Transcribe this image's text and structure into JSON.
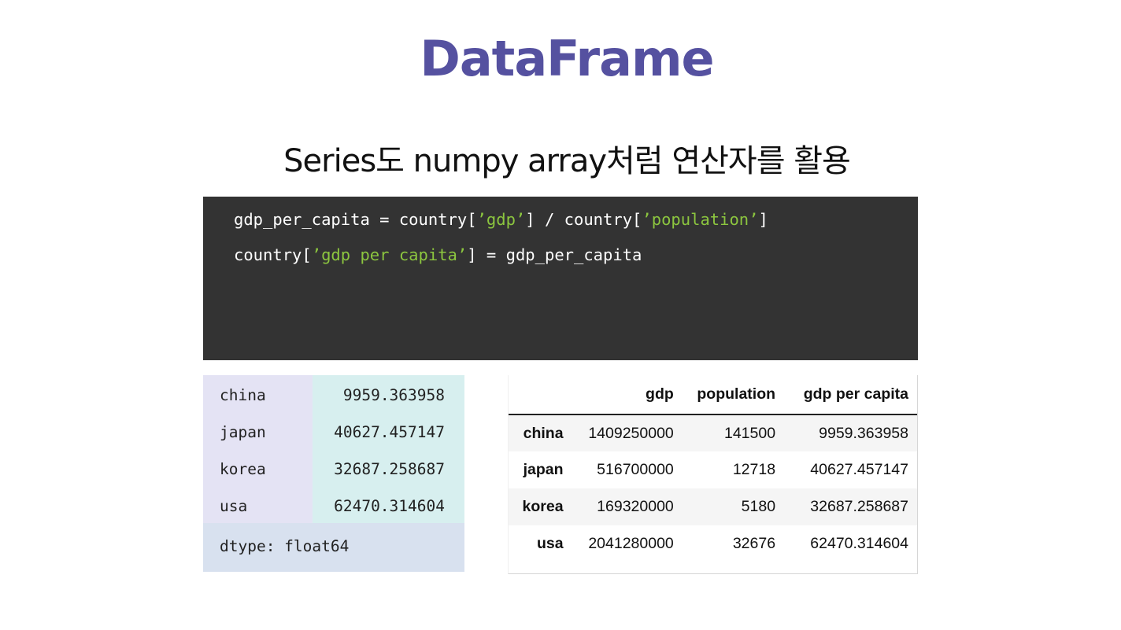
{
  "slide": {
    "title": "DataFrame",
    "subtitle": "Series도 numpy array처럼 연산자를 활용"
  },
  "code": {
    "line1": {
      "p1": "gdp_per_capita = country[",
      "s1": "’gdp’",
      "p2": "] / country[",
      "s2": "’population’",
      "p3": "]"
    },
    "line2": {
      "p1": "country[",
      "s1": "’gdp per capita’",
      "p2": "] = gdp_per_capita"
    }
  },
  "series_output": {
    "rows": [
      {
        "index": "china",
        "value": "9959.363958"
      },
      {
        "index": "japan",
        "value": "40627.457147"
      },
      {
        "index": "korea",
        "value": "32687.258687"
      },
      {
        "index": "usa",
        "value": "62470.314604"
      }
    ],
    "dtype": "dtype: float64"
  },
  "dataframe": {
    "columns": [
      "",
      "gdp",
      "population",
      "gdp per capita"
    ],
    "rows": [
      {
        "index": "china",
        "gdp": "1409250000",
        "population": "141500",
        "gdp_per_capita": "9959.363958"
      },
      {
        "index": "japan",
        "gdp": "516700000",
        "population": "12718",
        "gdp_per_capita": "40627.457147"
      },
      {
        "index": "korea",
        "gdp": "169320000",
        "population": "5180",
        "gdp_per_capita": "32687.258687"
      },
      {
        "index": "usa",
        "gdp": "2041280000",
        "population": "32676",
        "gdp_per_capita": "62470.314604"
      }
    ]
  },
  "colors": {
    "title": "#5551a0",
    "code_background": "#333333",
    "code_string": "#8cc63f",
    "series_index_bg": "#e4e3f4",
    "series_value_bg": "#d7efef",
    "series_dtype_bg": "#d8e1ef"
  }
}
